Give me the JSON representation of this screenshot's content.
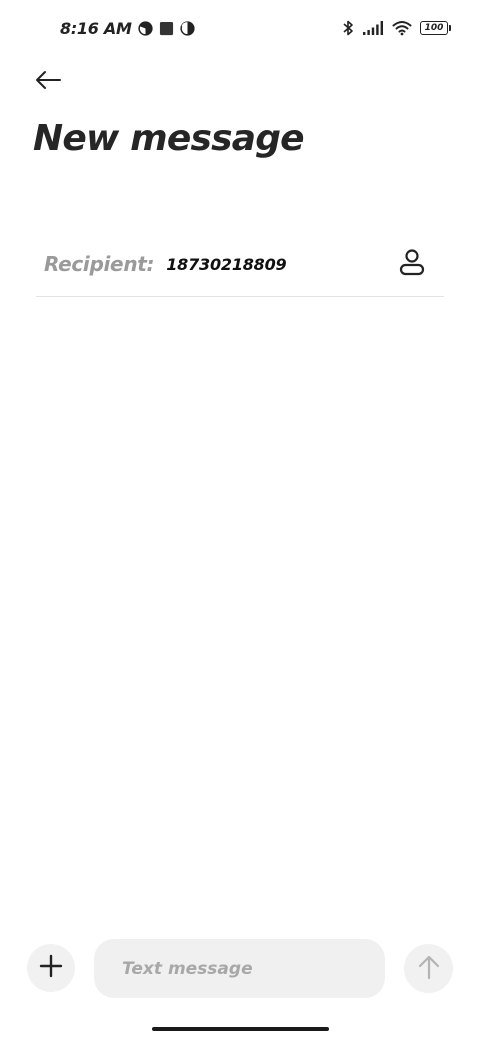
{
  "status_bar": {
    "time": "8:16 AM",
    "battery": "100",
    "left_icons": [
      "data-saver-icon",
      "square-notification-icon",
      "data-saver-icon"
    ],
    "right_icons": [
      "bluetooth-icon",
      "signal-icon",
      "wifi-icon",
      "battery-icon"
    ]
  },
  "header": {
    "back_icon": "arrow-left-icon",
    "title": "New message"
  },
  "recipient": {
    "label": "Recipient:",
    "value": "18730218809",
    "contact_icon": "person-icon"
  },
  "composer": {
    "attach_icon": "plus-icon",
    "placeholder": "Text message",
    "value": "",
    "send_icon": "arrow-up-icon"
  },
  "colors": {
    "background": "#ffffff",
    "input_background": "#f0f0f0",
    "label_gray": "#9a9a9a",
    "divider": "#e3e3e3"
  }
}
